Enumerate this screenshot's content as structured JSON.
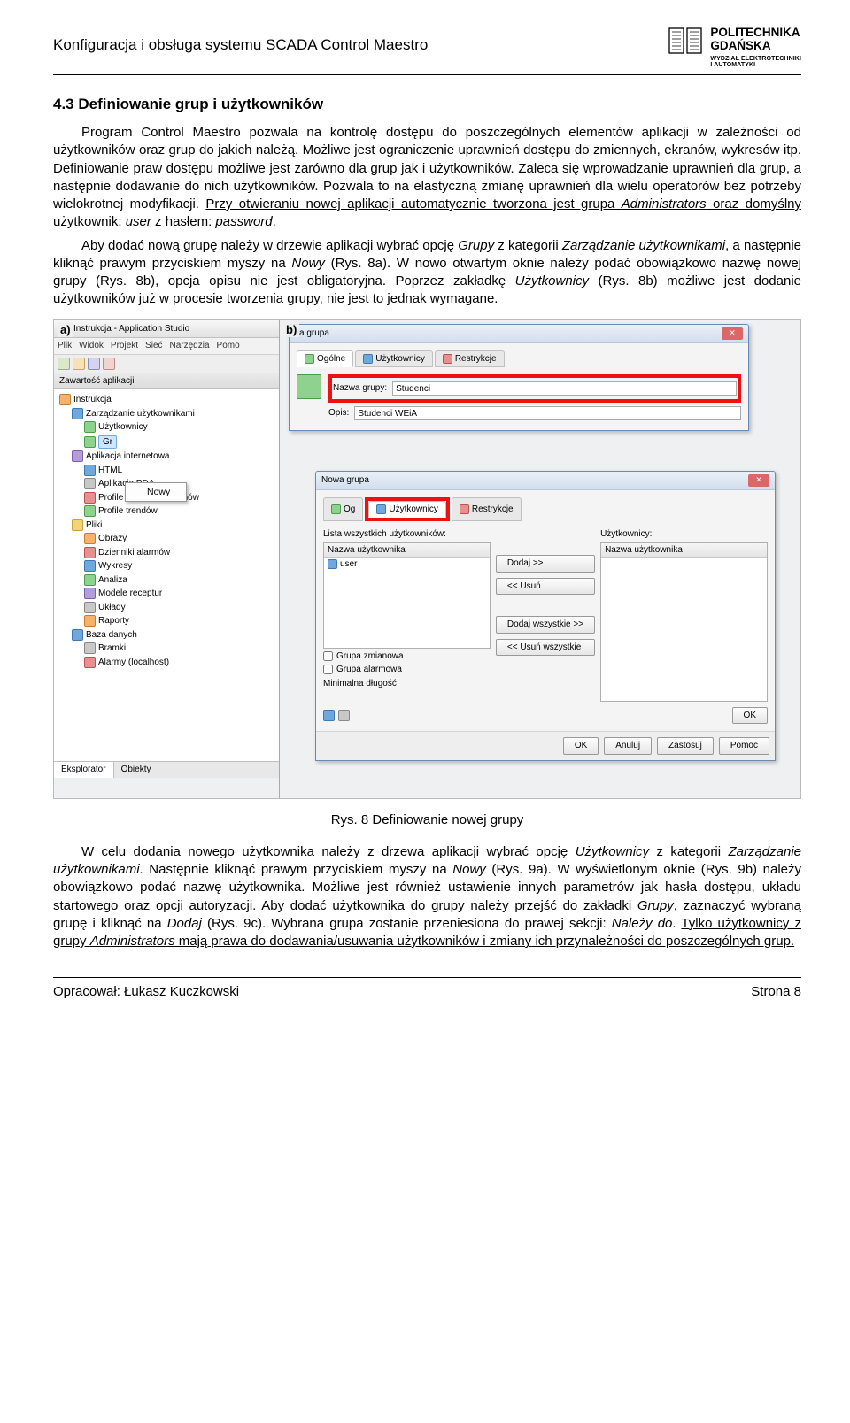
{
  "header": {
    "doc_title": "Konfiguracja i obsługa systemu SCADA Control Maestro",
    "uni_line1": "POLITECHNIKA",
    "uni_line2": "GDAŃSKA",
    "uni_sub1": "WYDZIAŁ ELEKTROTECHNIKI",
    "uni_sub2": "I AUTOMATYKI"
  },
  "section": {
    "heading": "4.3   Definiowanie grup i użytkowników",
    "p1a": "Program Control Maestro pozwala na kontrolę dostępu do poszczególnych elementów aplikacji w zależności od użytkowników oraz grup do jakich należą. Możliwe jest ograniczenie uprawnień dostępu do zmiennych, ekranów, wykresów itp. Definiowanie praw dostępu możliwe jest zarówno dla grup jak i użytkowników. Zaleca się wprowadzanie uprawnień dla grup, a następnie dodawanie do nich użytkowników. Pozwala to na elastyczną zmianę uprawnień dla wielu operatorów bez potrzeby wielokrotnej modyfikacji. ",
    "p1b": "Przy otwieraniu nowej aplikacji automatycznie tworzona jest grupa ",
    "p1c": "Administrators",
    "p1d": " oraz domyślny użytkownik: ",
    "p1e": "user",
    "p1f": " z hasłem: ",
    "p1g": "password",
    "p1h": ".",
    "p2a": "Aby dodać nową grupę należy w drzewie aplikacji wybrać opcję ",
    "p2b": "Grupy",
    "p2c": " z kategorii ",
    "p2d": "Zarządzanie użytkownikami",
    "p2e": ", a następnie kliknąć prawym przyciskiem myszy na ",
    "p2f": "Nowy",
    "p2g": " (Rys. 8a). W nowo otwartym oknie należy podać obowiązkowo nazwę nowej grupy (Rys. 8b), opcja opisu nie jest obligatoryjna. Poprzez zakładkę ",
    "p2h": "Użytkownicy",
    "p2i": " (Rys. 8b) możliwe jest dodanie użytkowników już w procesie tworzenia grupy, nie jest to jednak wymagane."
  },
  "panelA": {
    "label": "a)",
    "window_title": "Instrukcja - Application Studio",
    "menu": {
      "m1": "Plik",
      "m2": "Widok",
      "m3": "Projekt",
      "m4": "Sieć",
      "m5": "Narzędzia",
      "m6": "Pomo"
    },
    "tree_header": "Zawartość aplikacji",
    "root": "Instrukcja",
    "n_user_mgmt": "Zarządzanie użytkownikami",
    "n_users": "Użytkownicy",
    "n_gr": "Gr",
    "n_app_int": "Aplikacja internetowa",
    "n_html": "HTML",
    "n_app_pda": "Aplikacje PDA",
    "n_profile_alarm": "Profile dziennika alarmów",
    "n_profile_trend": "Profile trendów",
    "n_files": "Pliki",
    "n_images": "Obrazy",
    "n_alarm_log": "Dzienniki alarmów",
    "n_charts": "Wykresy",
    "n_analysis": "Analiza",
    "n_recipes": "Modele receptur",
    "n_layouts": "Układy",
    "n_reports": "Raporty",
    "n_db": "Baza danych",
    "n_gates": "Bramki",
    "n_alarms_local": "Alarmy (localhost)",
    "ctx_new": "Nowy",
    "tab_explorer": "Eksplorator",
    "tab_objects": "Obiekty"
  },
  "panelB": {
    "label": "b)",
    "dlg1_title": "va grupa",
    "tab_general": "Ogólne",
    "tab_users": "Użytkownicy",
    "tab_restr": "Restrykcje",
    "lbl_group_name": "Nazwa grupy:",
    "val_group_name": "Studenci",
    "lbl_desc": "Opis:",
    "val_desc": "Studenci WEiA",
    "dlg2_title": "Nowa grupa",
    "tab2_og": "Og",
    "list_all_label": "Lista wszystkich użytkowników:",
    "list_users_label": "Użytkownicy:",
    "col_username": "Nazwa użytkownika",
    "row_user": "user",
    "chk_group_var": "Grupa zmianowa",
    "chk_group_alarm": "Grupa alarmowa",
    "lbl_min_len": "Minimalna długość",
    "btn_ok": "OK",
    "btn_add": "Dodaj >>",
    "btn_remove": "<< Usuń",
    "btn_add_all": "Dodaj wszystkie >>",
    "btn_remove_all": "<< Usuń wszystkie",
    "btn_cancel": "Anuluj",
    "btn_apply": "Zastosuj",
    "btn_help": "Pomoc"
  },
  "caption": "Rys. 8 Definiowanie nowej grupy",
  "para3": {
    "a": "W celu dodania nowego użytkownika należy z drzewa aplikacji wybrać opcję ",
    "b": "Użytkownicy",
    "c": " z kategorii ",
    "d": "Zarządzanie użytkownikami",
    "e": ". Następnie kliknąć prawym przyciskiem myszy na ",
    "f": "Nowy",
    "g": " (Rys. 9a). W wyświetlonym oknie (Rys. 9b) należy obowiązkowo podać nazwę użytkownika. Możliwe jest również ustawienie innych parametrów jak hasła dostępu, układu startowego oraz opcji autoryzacji. Aby dodać użytkownika do grupy należy przejść do zakładki ",
    "h": "Grupy",
    "i": ", zaznaczyć wybraną grupę i kliknąć na ",
    "j": "Dodaj",
    "k": " (Rys. 9c). Wybrana grupa zostanie przeniesiona do prawej sekcji: ",
    "l": "Należy do",
    "m": ". ",
    "n": "Tylko użytkownicy z grupy ",
    "o": "Administrators",
    "p": " mają prawa do dodawania/usuwania użytkowników i zmiany ich przynależności do poszczególnych grup."
  },
  "footer": {
    "left": "Opracował: Łukasz Kuczkowski",
    "right": "Strona 8"
  }
}
